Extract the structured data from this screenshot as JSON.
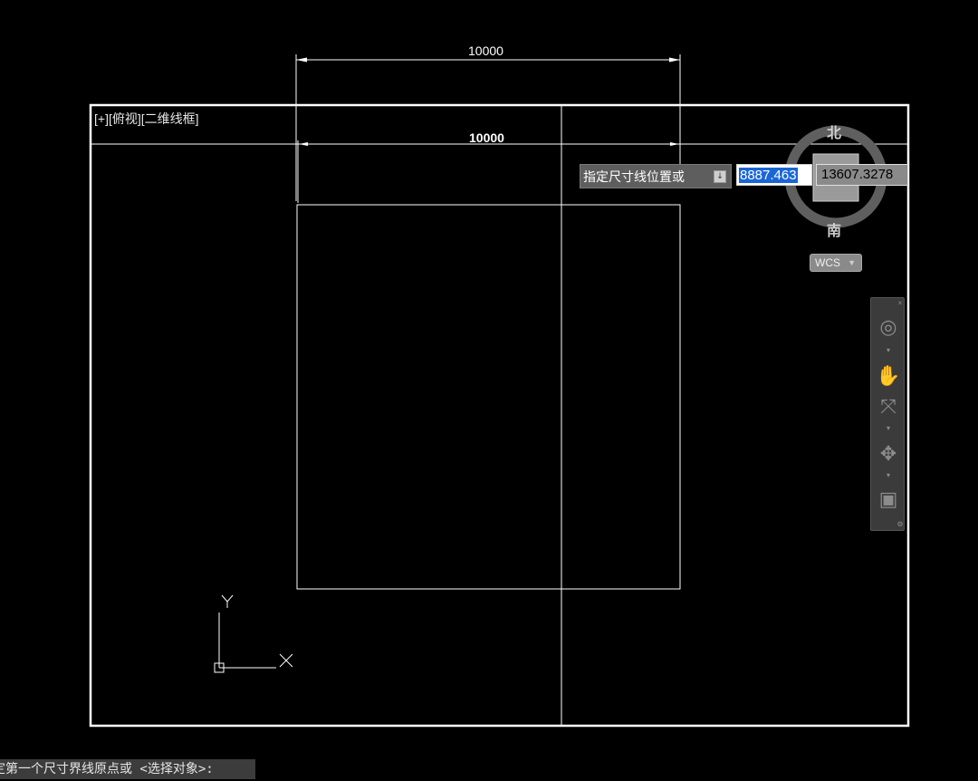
{
  "viewport": {
    "label": "[+][俯视][二维线框]"
  },
  "dimensions": {
    "outer": "10000",
    "inner": "10000"
  },
  "dynamic_input": {
    "prompt": "指定尺寸线位置或",
    "value_1": "8887.463",
    "value_2": "13607.3278"
  },
  "viewcube": {
    "north": "北",
    "south": "南",
    "wcs": "WCS"
  },
  "ucs": {
    "x_label": "X",
    "y_label": "Y"
  },
  "navigation_bar": {
    "tools": [
      "steering-wheel-icon",
      "pan-hand-icon",
      "zoom-icon",
      "orbit-icon",
      "showmotion-icon"
    ]
  },
  "command_line": {
    "text": "定第一个尺寸界线原点或 <选择对象>:"
  }
}
